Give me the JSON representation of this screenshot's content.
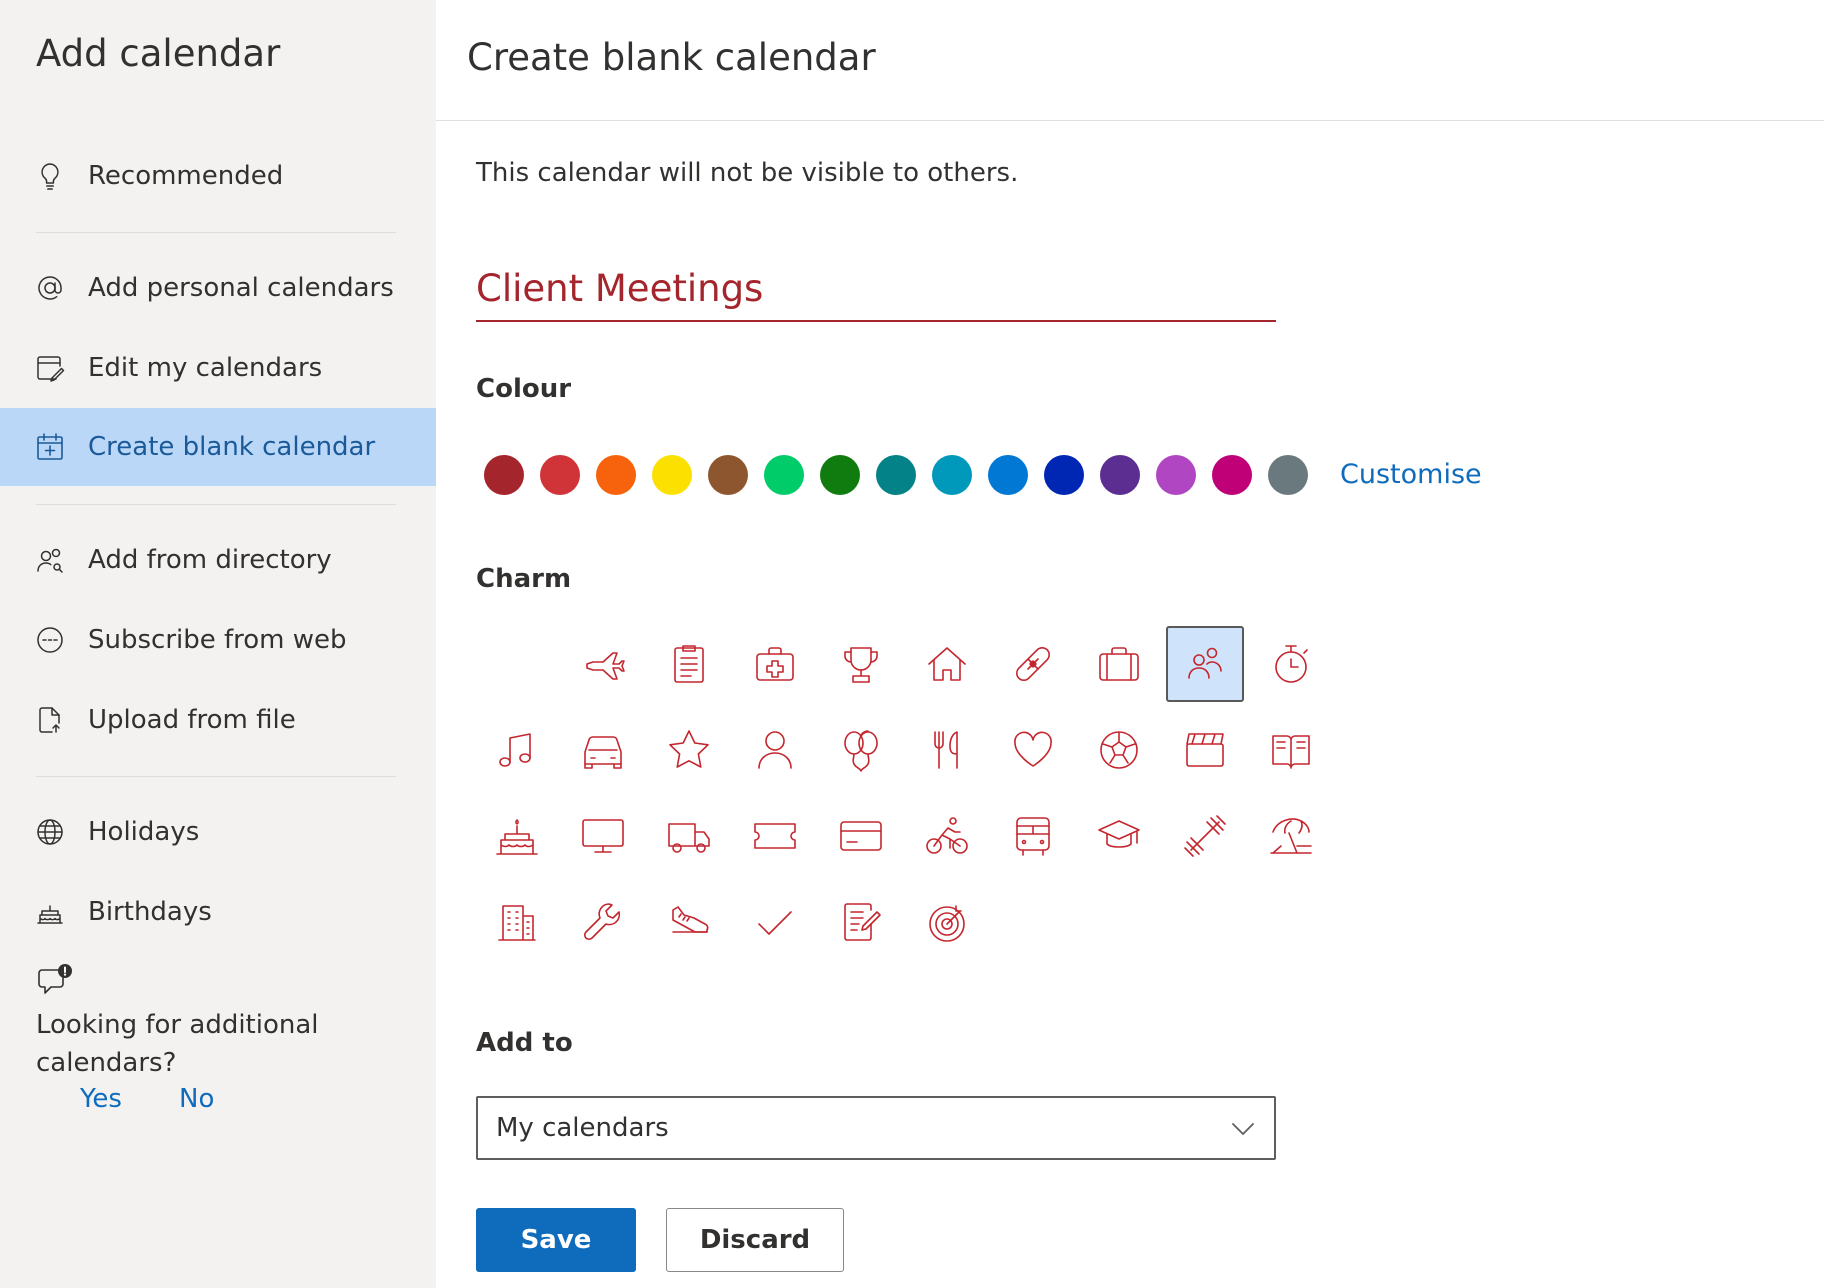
{
  "sidebar": {
    "title": "Add calendar",
    "items": [
      {
        "label": "Recommended",
        "icon": "lightbulb-icon"
      },
      {
        "label": "Add personal calendars",
        "icon": "at-sign-icon"
      },
      {
        "label": "Edit my calendars",
        "icon": "edit-calendar-icon"
      },
      {
        "label": "Create blank calendar",
        "icon": "calendar-add-icon",
        "selected": true
      },
      {
        "label": "Add from directory",
        "icon": "people-search-icon"
      },
      {
        "label": "Subscribe from web",
        "icon": "link-circle-icon"
      },
      {
        "label": "Upload from file",
        "icon": "document-arrow-icon"
      },
      {
        "label": "Holidays",
        "icon": "globe-icon"
      },
      {
        "label": "Birthdays",
        "icon": "birthday-cake-icon"
      }
    ],
    "feedback": {
      "question": "Looking for additional calendars?",
      "yes": "Yes",
      "no": "No"
    }
  },
  "main": {
    "title": "Create blank calendar",
    "info": "This calendar will not be visible to others.",
    "calendar_name": "Client Meetings",
    "colour_label": "Colour",
    "colours": [
      "#a4262c",
      "#d13438",
      "#f7630c",
      "#fce100",
      "#8e562e",
      "#00cc6a",
      "#107c10",
      "#038387",
      "#0099bc",
      "#0078d4",
      "#0027b4",
      "#5c2e91",
      "#b146c2",
      "#bf0077",
      "#69797e"
    ],
    "customise_label": "Customise",
    "charm_label": "Charm",
    "charms": [
      "blank",
      "airplane-icon",
      "clipboard-icon",
      "medical-kit-icon",
      "trophy-icon",
      "home-icon",
      "bandage-icon",
      "briefcase-icon",
      "people-icon",
      "stopwatch-icon",
      "music-note-icon",
      "car-icon",
      "star-icon",
      "person-icon",
      "balloons-icon",
      "fork-knife-icon",
      "heart-icon",
      "soccer-ball-icon",
      "clapperboard-icon",
      "book-icon",
      "birthday-cake-icon",
      "monitor-icon",
      "truck-icon",
      "ticket-icon",
      "credit-card-icon",
      "cyclist-icon",
      "bus-icon",
      "graduation-cap-icon",
      "dumbbell-icon",
      "beach-umbrella-icon",
      "building-icon",
      "wrench-icon",
      "running-shoe-icon",
      "checkmark-icon",
      "note-edit-icon",
      "target-icon"
    ],
    "selected_charm": "people-icon",
    "addto_label": "Add to",
    "addto_value": "My calendars",
    "save_label": "Save",
    "discard_label": "Discard",
    "accent_color": "#0f6cbd",
    "charm_color": "#c4262e"
  }
}
